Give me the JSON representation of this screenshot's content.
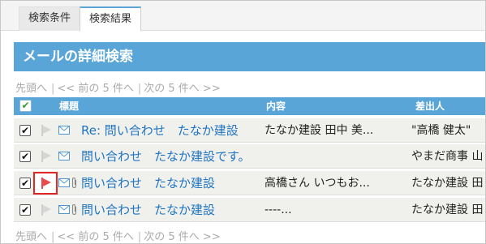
{
  "tabs": [
    {
      "label": "検索条件"
    },
    {
      "label": "検索結果"
    }
  ],
  "page_title": "メールの詳細検索",
  "pager": {
    "first": "先頭へ",
    "prev": "<< 前の 5 件へ",
    "next": "次の 5 件へ >>",
    "separator": "|"
  },
  "table": {
    "header_check": "✔",
    "columns": {
      "subject": "標題",
      "content": "内容",
      "sender": "差出人"
    },
    "rows": [
      {
        "checked": "✔",
        "subject": "Re: 問い合わせ　たなか建設",
        "content": "たなか建設 田中 美...",
        "sender": "\"高橋 健太\"",
        "has_attachment": false,
        "flagged": false
      },
      {
        "checked": "✔",
        "subject": "問い合わせ　たなか建設です。",
        "content": "",
        "sender": "やまだ商事 山",
        "has_attachment": false,
        "flagged": false
      },
      {
        "checked": "✔",
        "subject": "問い合わせ　たなか建設",
        "content": "高橋さん いつもお...",
        "sender": "たなか建設 田",
        "has_attachment": true,
        "flagged": true
      },
      {
        "checked": "✔",
        "subject": "問い合わせ　たなか建設",
        "content": "----...",
        "sender": "たなか建設 田",
        "has_attachment": true,
        "flagged": false
      }
    ]
  },
  "colors": {
    "accent": "#5aa5d8",
    "link": "#1f74c2",
    "flag_active": "#e84b4b",
    "flag_inactive": "#cfcfcf",
    "highlight_border": "#e32424"
  }
}
